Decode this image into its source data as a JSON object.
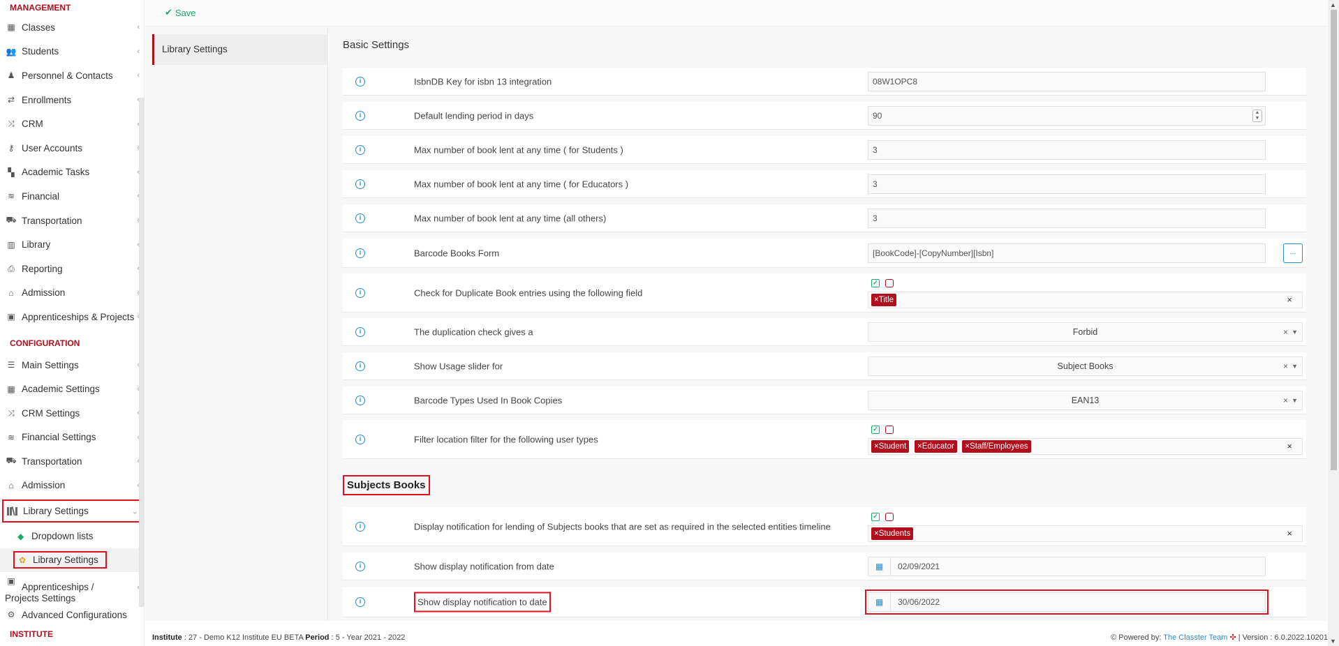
{
  "toolbar": {
    "save_label": "Save"
  },
  "sidebar": {
    "management_title": "MANAGEMENT",
    "configuration_title": "CONFIGURATION",
    "institute_title": "INSTITUTE",
    "management": [
      {
        "label": "Classes",
        "icon": "classes-icon"
      },
      {
        "label": "Students",
        "icon": "students-icon"
      },
      {
        "label": "Personnel & Contacts",
        "icon": "personnel-icon"
      },
      {
        "label": "Enrollments",
        "icon": "exchange-icon"
      },
      {
        "label": "CRM",
        "icon": "shuffle-icon"
      },
      {
        "label": "User Accounts",
        "icon": "key-icon"
      },
      {
        "label": "Academic Tasks",
        "icon": "grid-icon"
      },
      {
        "label": "Financial",
        "icon": "coins-icon"
      },
      {
        "label": "Transportation",
        "icon": "bus-icon"
      },
      {
        "label": "Library",
        "icon": "books-icon"
      },
      {
        "label": "Reporting",
        "icon": "print-icon"
      },
      {
        "label": "Admission",
        "icon": "institution-icon"
      },
      {
        "label": "Apprenticeships & Projects",
        "icon": "cube-icon"
      }
    ],
    "configuration": [
      {
        "label": "Main Settings",
        "icon": "sliders-icon"
      },
      {
        "label": "Academic Settings",
        "icon": "classes-icon"
      },
      {
        "label": "CRM Settings",
        "icon": "shuffle-icon"
      },
      {
        "label": "Financial Settings",
        "icon": "coins-icon"
      },
      {
        "label": "Transportation",
        "icon": "bus-icon"
      },
      {
        "label": "Admission",
        "icon": "institution-icon"
      }
    ],
    "library_settings": "Library Settings",
    "sub_dropdown": "Dropdown lists",
    "sub_library": "Library Settings",
    "apprenticeships_settings": "Apprenticeships / Projects Settings",
    "advanced": "Advanced Configurations"
  },
  "tabs": {
    "active": "Library Settings"
  },
  "basic": {
    "title": "Basic Settings",
    "isbn_label": "IsbnDB Key for isbn 13 integration",
    "isbn_value": "08W1OPC8",
    "lending_label": "Default lending period in days",
    "lending_value": "90",
    "max_students_label": "Max number of book lent at any time ( for Students )",
    "max_students_value": "3",
    "max_educators_label": "Max number of book lent at any time ( for Educators )",
    "max_educators_value": "3",
    "max_others_label": "Max number of book lent at any time (all others)",
    "max_others_value": "3",
    "barcode_form_label": "Barcode Books Form",
    "barcode_form_value": "[BookCode]-[CopyNumber][Isbn]",
    "barcode_form_button": "...",
    "dup_check_label": "Check for Duplicate Book entries using the following field",
    "dup_check_tags": [
      "×Title"
    ],
    "dup_result_label": "The duplication check gives a",
    "dup_result_value": "Forbid",
    "usage_slider_label": "Show Usage slider for",
    "usage_slider_value": "Subject Books",
    "barcode_types_label": "Barcode Types Used In Book Copies",
    "barcode_types_value": "EAN13",
    "filter_location_label": "Filter location filter for the following user types",
    "filter_location_tags": [
      "×Student",
      "×Educator",
      "×Staff/Employees"
    ]
  },
  "subjects": {
    "title": "Subjects Books",
    "notify_label": "Display notification for lending of Subjects books that are set as required in the selected entities timeline",
    "notify_tags": [
      "×Students"
    ],
    "from_label": "Show display notification from date",
    "from_value": "02/09/2021",
    "to_label": "Show display notification to date",
    "to_value": "30/06/2022"
  },
  "footer": {
    "institute_label": "Institute",
    "institute_value": ": 27 - Demo K12 Institute EU BETA",
    "period_label": "Period",
    "period_value": ": 5 - Year 2021 - 2022",
    "powered_by": "Powered by:",
    "team": "The Classter Team",
    "version": "| Version : 6.0.2022.10201"
  },
  "colors": {
    "accent": "#b10e1e",
    "success": "#1aab6b",
    "link": "#2a8dc7",
    "highlight": "#e0101f"
  }
}
